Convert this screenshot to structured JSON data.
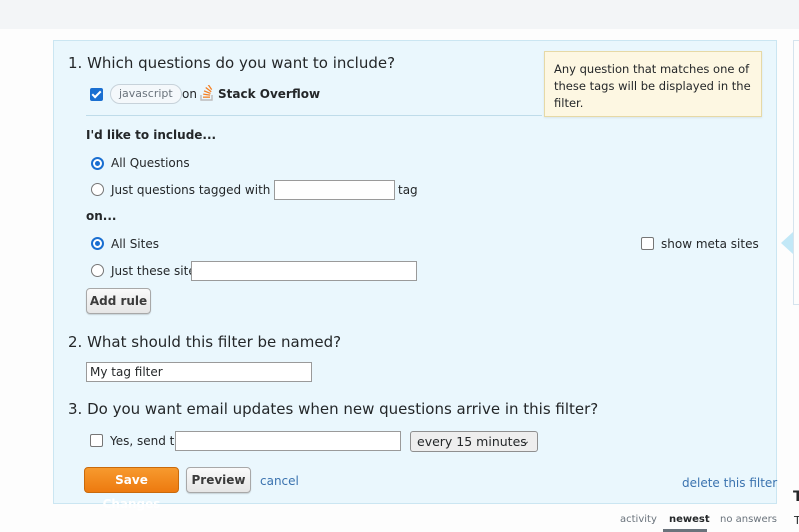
{
  "section1": {
    "heading": "1. Which questions do you want to include?",
    "rule": {
      "checked": true,
      "tag": "javascript",
      "on_label": "on",
      "site_name": "Stack Overflow",
      "site_icon": "stackoverflow-logo-icon"
    },
    "tooltip": "Any question that matches one of these tags will be displayed in the filter.",
    "include_label": "I'd like to include...",
    "include_options": [
      {
        "label": "All Questions",
        "selected": true
      },
      {
        "label": "Just questions tagged with the",
        "selected": false,
        "suffix": "tag",
        "input_value": ""
      }
    ],
    "on_label": "on...",
    "site_options": [
      {
        "label": "All Sites",
        "selected": true
      },
      {
        "label": "Just these sites",
        "selected": false,
        "input_value": ""
      }
    ],
    "show_meta_sites": {
      "label": "show meta sites",
      "checked": false
    },
    "add_rule_label": "Add rule"
  },
  "section2": {
    "heading": "2. What should this filter be named?",
    "name_value": "My tag filter"
  },
  "section3": {
    "heading": "3. Do you want email updates when new questions arrive in this filter?",
    "send_label": "Yes, send to",
    "send_checked": false,
    "email_value": "",
    "frequency": "every 15 minutes"
  },
  "actions": {
    "save_label": "Save Changes",
    "preview_label": "Preview",
    "cancel_label": "cancel",
    "delete_label": "delete this filter"
  },
  "sort_tabs": [
    {
      "label": "activity",
      "active": false
    },
    {
      "label": "newest",
      "active": true
    },
    {
      "label": "no answers",
      "active": false
    }
  ],
  "side": {
    "heading_fragment": "T",
    "text_fragment": "T"
  },
  "colors": {
    "accent_blue": "#1a6fd1",
    "link": "#3b73af",
    "save_button": "#f48024",
    "panel_bg": "#eaf7fd",
    "tooltip_bg": "#fdf7e2"
  }
}
